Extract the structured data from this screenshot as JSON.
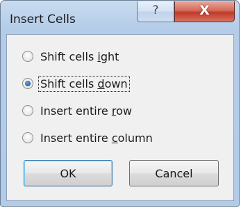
{
  "window": {
    "title": "Insert Cells",
    "help_glyph": "?",
    "close_glyph": "X"
  },
  "options": [
    {
      "label_pre": "Shift cells ",
      "mnemonic": "i",
      "label_post": "ght",
      "checked": false
    },
    {
      "label_pre": "Shift cells ",
      "mnemonic": "d",
      "label_post": "own",
      "checked": true
    },
    {
      "label_pre": "Insert entire ",
      "mnemonic": "r",
      "label_post": "ow",
      "checked": false
    },
    {
      "label_pre": "Insert entire ",
      "mnemonic": "c",
      "label_post": "olumn",
      "checked": false
    }
  ],
  "buttons": {
    "ok_label": "OK",
    "cancel_label": "Cancel"
  },
  "icons": {
    "help": "help-icon",
    "close": "close-icon"
  },
  "colors": {
    "title_bar": "#b4cce8",
    "close_button": "#c0392b",
    "dialog_background": "#f0f0f0"
  }
}
